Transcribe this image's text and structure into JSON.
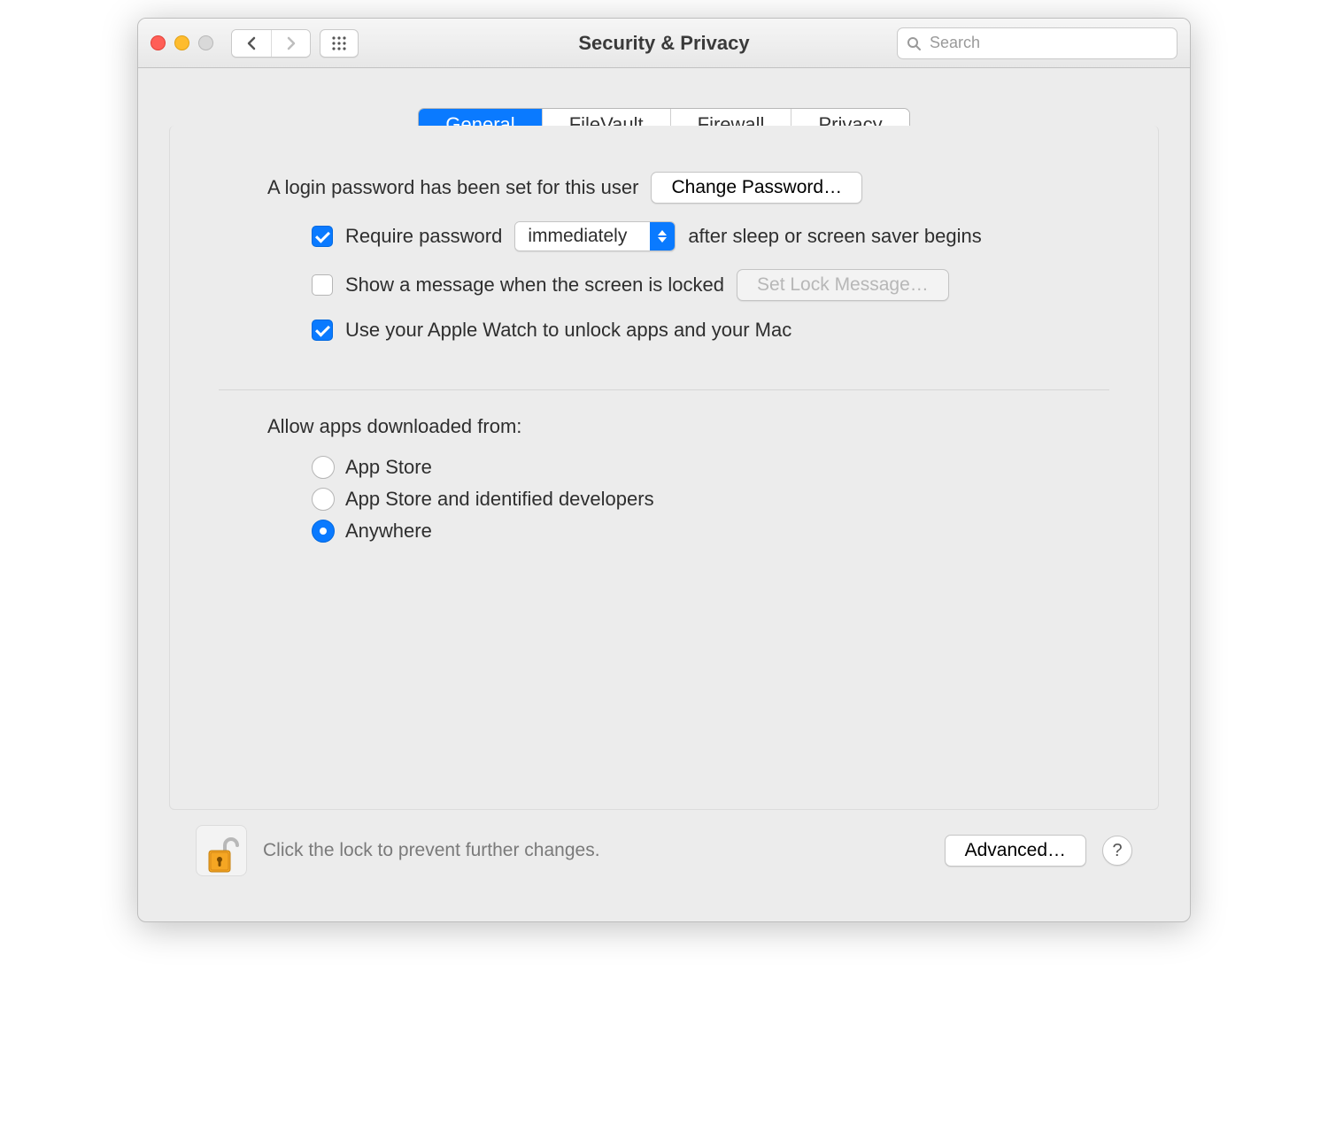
{
  "window": {
    "title": "Security & Privacy"
  },
  "toolbar": {
    "search_placeholder": "Search"
  },
  "tabs": [
    {
      "label": "General",
      "active": true
    },
    {
      "label": "FileVault",
      "active": false
    },
    {
      "label": "Firewall",
      "active": false
    },
    {
      "label": "Privacy",
      "active": false
    }
  ],
  "general": {
    "login_password_set_label": "A login password has been set for this user",
    "change_password_label": "Change Password…",
    "require_password": {
      "checked": true,
      "label_before": "Require password",
      "select_value": "immediately",
      "label_after": "after sleep or screen saver begins"
    },
    "show_lock_message": {
      "checked": false,
      "label": "Show a message when the screen is locked",
      "set_message_label": "Set Lock Message…",
      "set_message_enabled": false
    },
    "apple_watch": {
      "checked": true,
      "label": "Use your Apple Watch to unlock apps and your Mac"
    },
    "allow_apps": {
      "heading": "Allow apps downloaded from:",
      "options": [
        {
          "label": "App Store",
          "selected": false
        },
        {
          "label": "App Store and identified developers",
          "selected": false
        },
        {
          "label": "Anywhere",
          "selected": true
        }
      ]
    }
  },
  "footer": {
    "lock_message": "Click the lock to prevent further changes.",
    "advanced_label": "Advanced…",
    "help_label": "?"
  }
}
